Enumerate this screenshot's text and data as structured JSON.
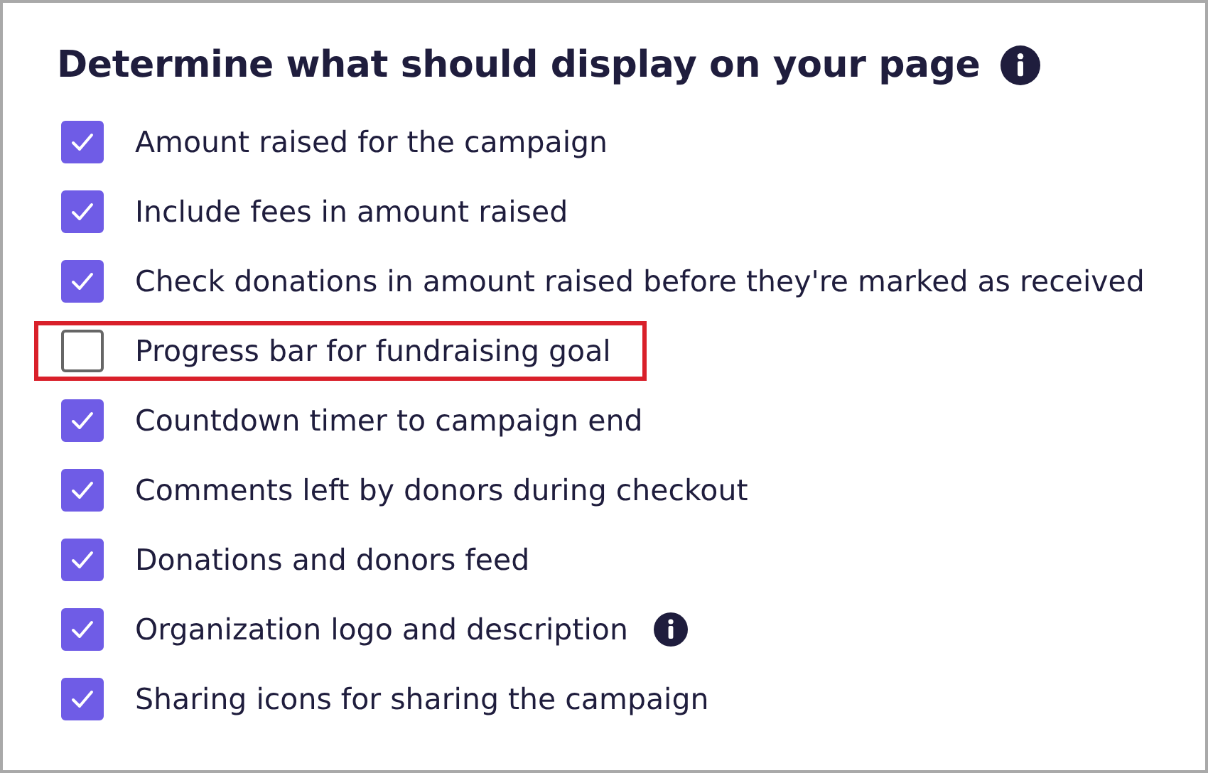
{
  "heading": "Determine what should display on your page",
  "options": [
    {
      "label": "Amount raised for the campaign",
      "checked": true,
      "highlighted": false,
      "info": false
    },
    {
      "label": "Include fees in amount raised",
      "checked": true,
      "highlighted": false,
      "info": false
    },
    {
      "label": "Check donations in amount raised before they're marked as received",
      "checked": true,
      "highlighted": false,
      "info": false
    },
    {
      "label": "Progress bar for fundraising goal",
      "checked": false,
      "highlighted": true,
      "info": false
    },
    {
      "label": "Countdown timer to campaign end",
      "checked": true,
      "highlighted": false,
      "info": false
    },
    {
      "label": "Comments left by donors during checkout",
      "checked": true,
      "highlighted": false,
      "info": false
    },
    {
      "label": "Donations and donors feed",
      "checked": true,
      "highlighted": false,
      "info": false
    },
    {
      "label": "Organization logo and description",
      "checked": true,
      "highlighted": false,
      "info": true
    },
    {
      "label": "Sharing icons for sharing the campaign",
      "checked": true,
      "highlighted": false,
      "info": false
    }
  ]
}
